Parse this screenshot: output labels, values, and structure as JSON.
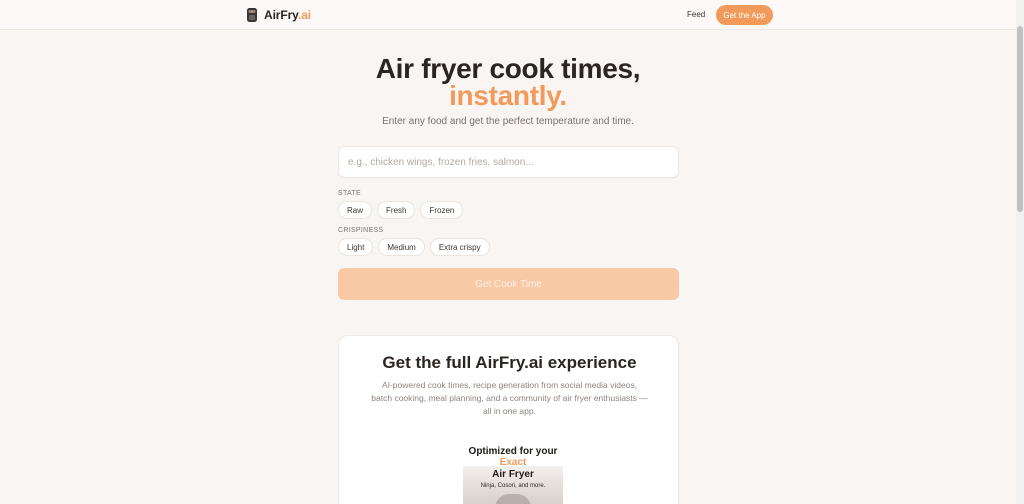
{
  "nav": {
    "brand_name": "AirFry",
    "brand_suffix": ".ai",
    "feed_label": "Feed",
    "cta_label": "Get the App"
  },
  "hero": {
    "title_line1": "Air fryer cook times,",
    "title_line2": "instantly.",
    "subtitle": "Enter any food and get the perfect temperature and time."
  },
  "search": {
    "placeholder": "e.g., chicken wings, frozen fries, salmon...",
    "value": ""
  },
  "state": {
    "label": "STATE",
    "options": [
      "Raw",
      "Fresh",
      "Frozen"
    ]
  },
  "crispiness": {
    "label": "CRISPINESS",
    "options": [
      "Light",
      "Medium",
      "Extra crispy"
    ]
  },
  "submit_label": "Get Cook Time",
  "promo_card": {
    "title": "Get the full AirFry.ai experience",
    "description": "AI-powered cook times, recipe generation from social media videos, batch cooking, meal planning, and a community of air fryer enthusiasts — all in one app.",
    "image_line1": "Optimized for your",
    "image_line2": "Exact",
    "image_line3": "Air Fryer",
    "image_line4": "Ninja, Cosori, and more."
  },
  "colors": {
    "accent": "#f29a5a",
    "background": "#f8f5f3",
    "button_disabled": "#f9c9a6"
  },
  "icons": {
    "brand": "air-fryer-icon"
  }
}
